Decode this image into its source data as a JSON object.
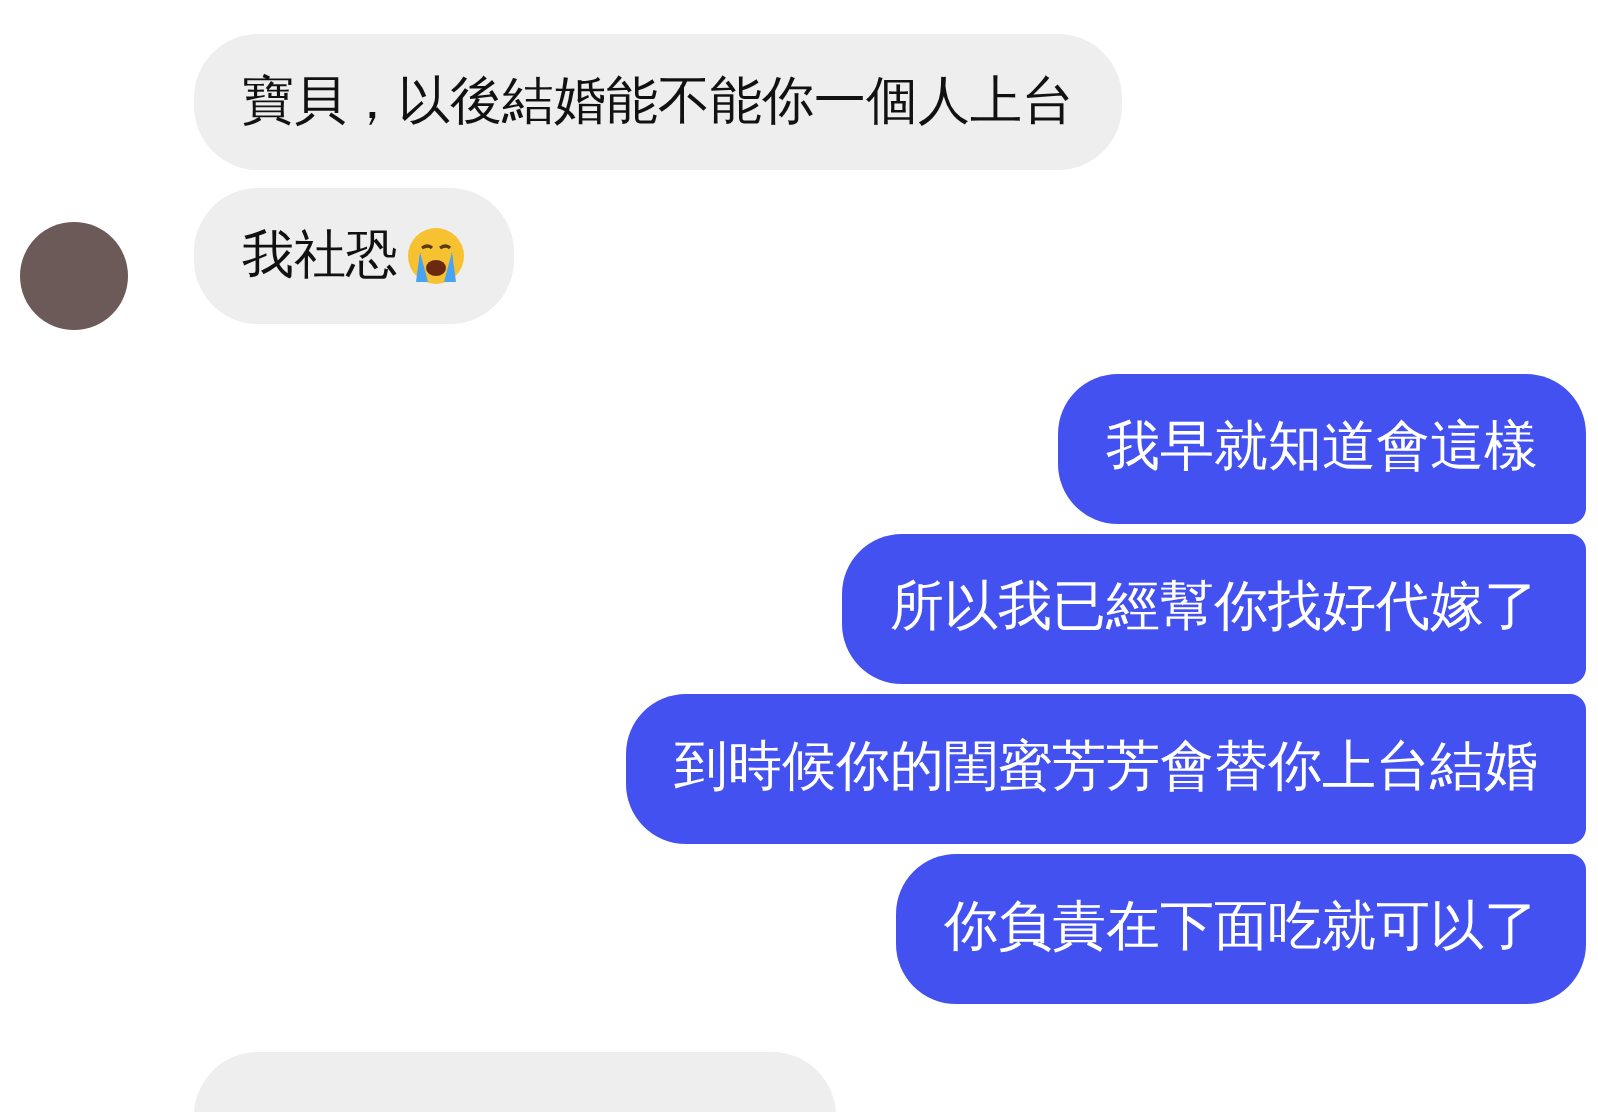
{
  "messages": [
    {
      "kind": "incoming",
      "text": "寶貝，以後結婚能不能你一個人上台",
      "avatar": false,
      "emoji": false
    },
    {
      "kind": "incoming",
      "text": "我社恐",
      "avatar": true,
      "emoji": true
    },
    {
      "kind": "outgoing",
      "text": "我早就知道會這樣"
    },
    {
      "kind": "outgoing",
      "text": "所以我已經幫你找好代嫁了"
    },
    {
      "kind": "outgoing",
      "text": "到時候你的閨蜜芳芳會替你上台結婚"
    },
    {
      "kind": "outgoing",
      "text": "你負責在下面吃就可以了"
    }
  ]
}
